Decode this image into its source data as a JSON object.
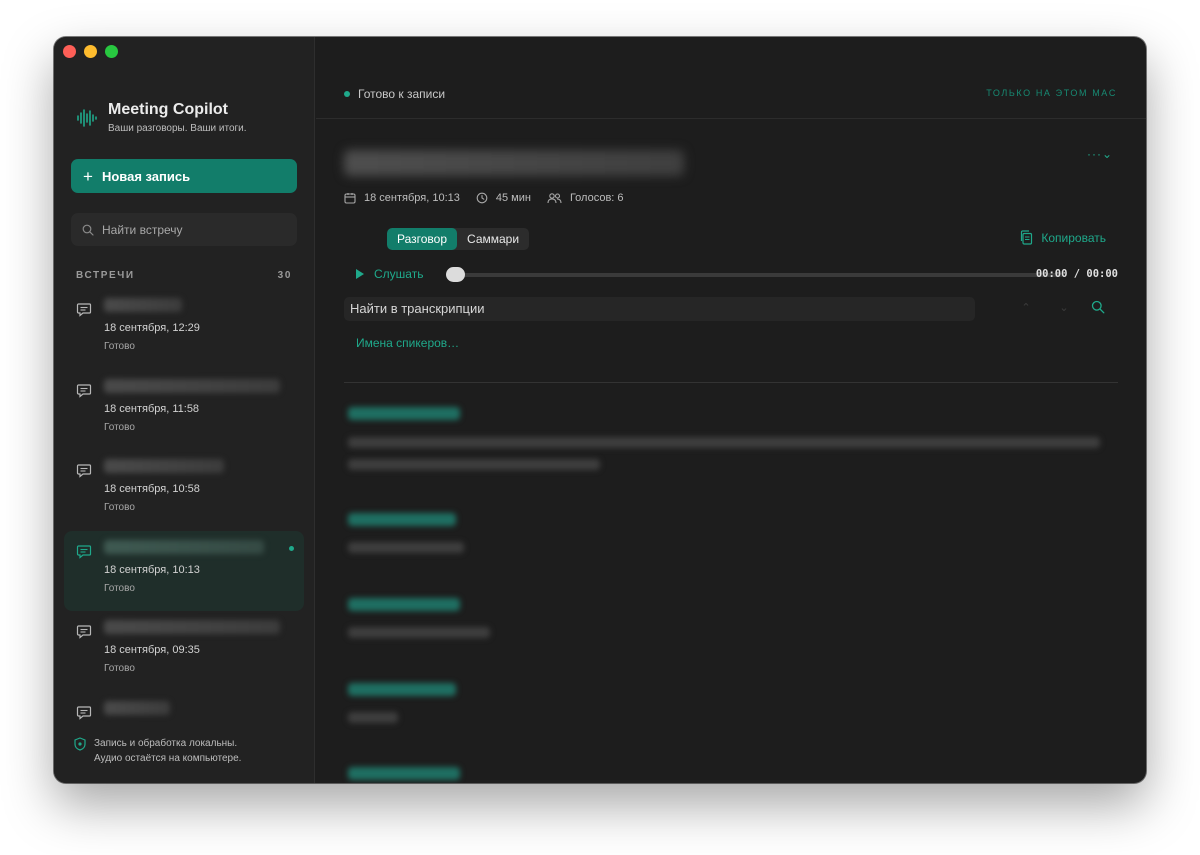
{
  "app": {
    "title": "Meeting Copilot",
    "subtitle": "Ваши разговоры. Ваши итоги.",
    "accent_color": "#127d6a"
  },
  "sidebar": {
    "new_button_label": "Новая запись",
    "search_placeholder": "Найти встречу",
    "section_label": "ВСТРЕЧИ",
    "section_count": "30",
    "meetings": [
      {
        "title": "",
        "date": "18 сентября, 12:29",
        "status": "Готово",
        "active": false
      },
      {
        "title": "",
        "date": "18 сентября, 11:58",
        "status": "Готово",
        "active": false
      },
      {
        "title": "",
        "date": "18 сентября, 10:58",
        "status": "Готово",
        "active": false
      },
      {
        "title": "",
        "date": "18 сентября, 10:13",
        "status": "Готово",
        "active": true
      },
      {
        "title": "",
        "date": "18 сентября, 09:35",
        "status": "Готово",
        "active": false
      },
      {
        "title": "",
        "date": "",
        "status": "",
        "active": false
      }
    ],
    "footer_line1": "Запись и обработка локальны.",
    "footer_line2": "Аудио остаётся на компьютере."
  },
  "topbar": {
    "status": "Готово к записи",
    "privacy_badge": "ТОЛЬКО НА ЭТОМ MAC"
  },
  "recording": {
    "title": "",
    "more_label": "···⌄",
    "date": "18 сентября, 10:13",
    "duration": "45 мин",
    "voices": "Голосов: 6"
  },
  "tabs": [
    {
      "label": "Разговор",
      "active": true
    },
    {
      "label": "Саммари",
      "active": false
    }
  ],
  "copy_label": "Копировать",
  "player": {
    "listen_label": "Слушать",
    "time": "00:00 / 00:00",
    "progress": 0
  },
  "transcript_search": {
    "placeholder": "Найти в транскрипции",
    "prev_label": "⌃",
    "next_label": "⌄"
  },
  "speaker_names_label": "Имена спикеров…"
}
